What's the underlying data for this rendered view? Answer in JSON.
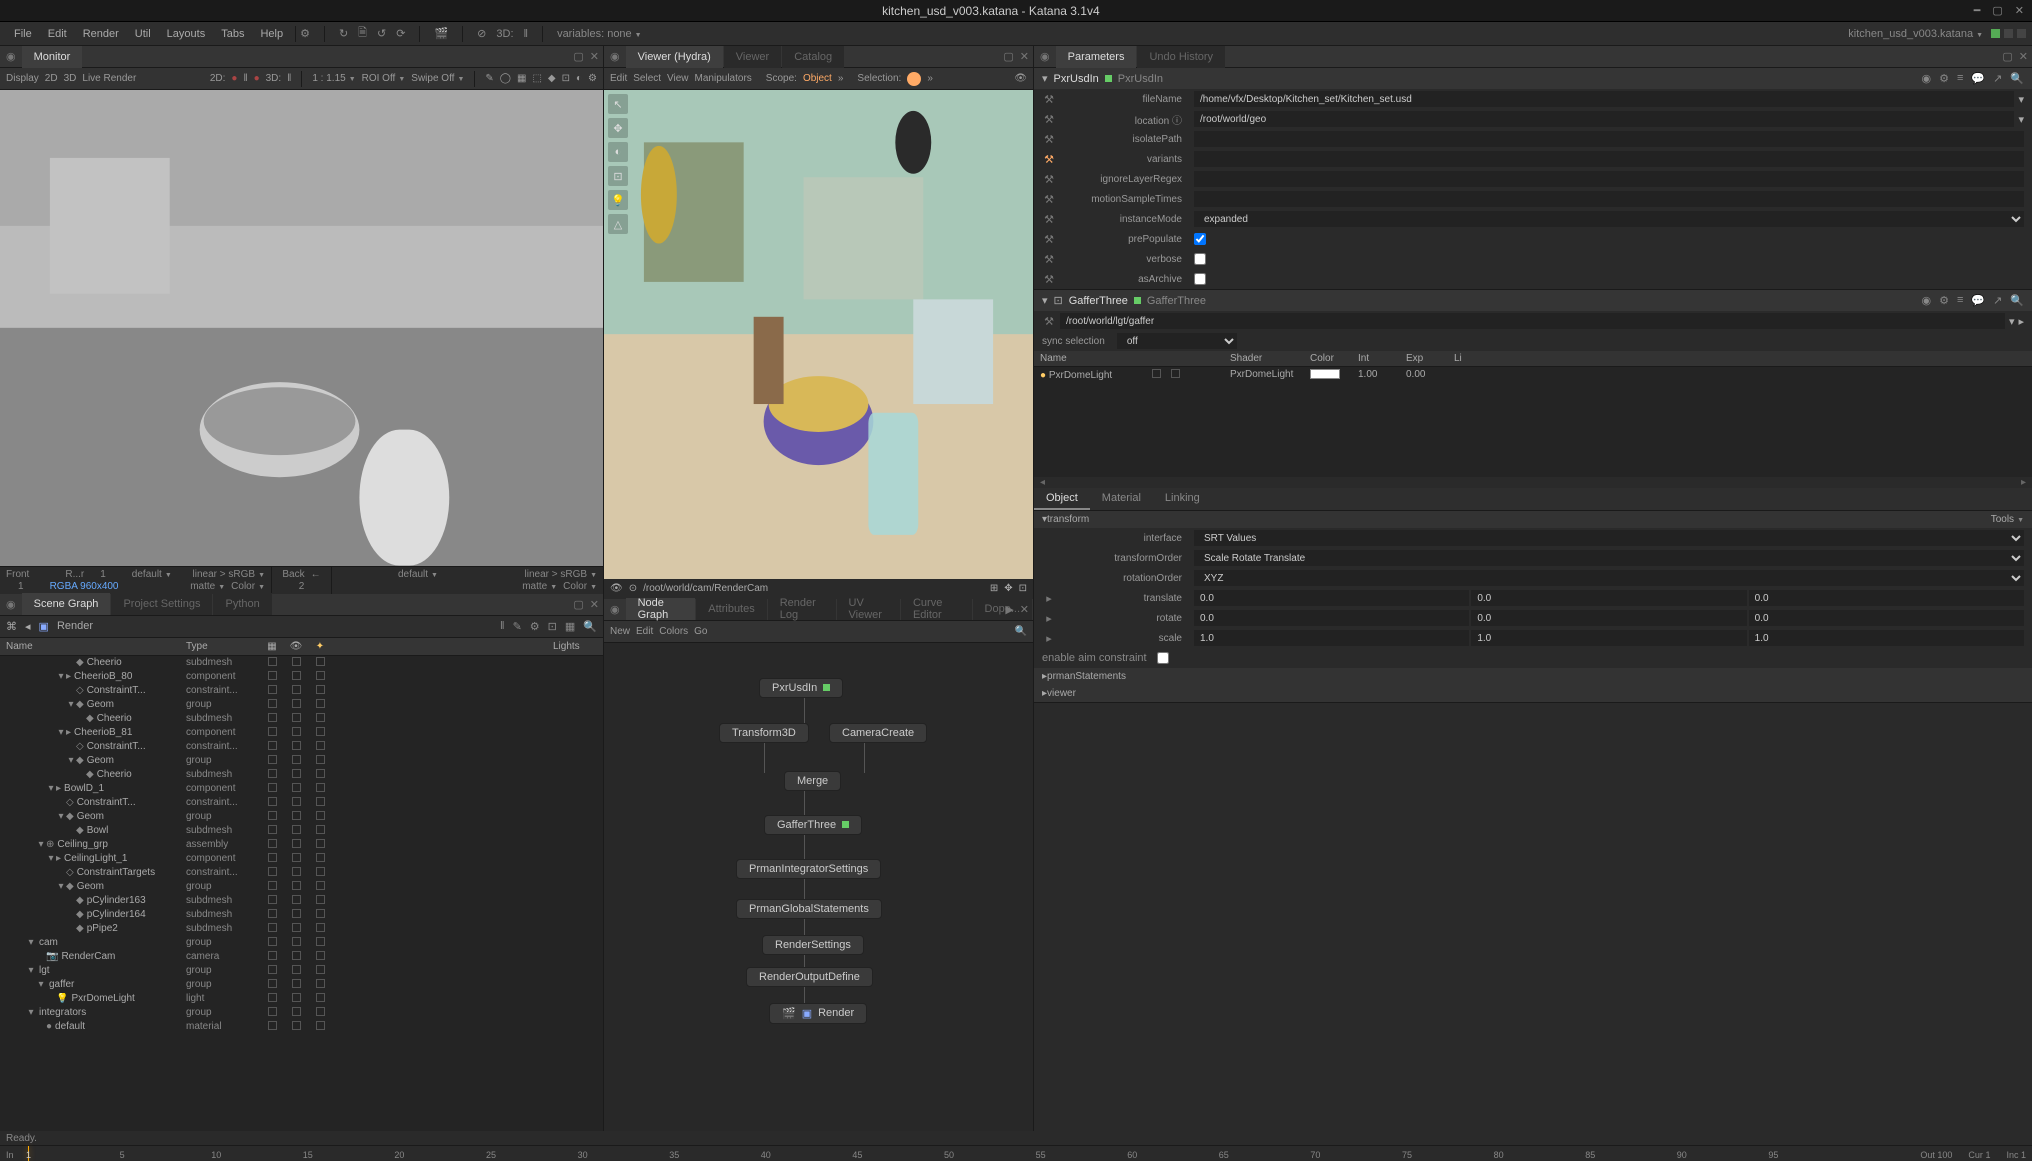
{
  "window": {
    "title": "kitchen_usd_v003.katana - Katana 3.1v4"
  },
  "menubar": {
    "items": [
      "File",
      "Edit",
      "Render",
      "Util",
      "Layouts",
      "Tabs",
      "Help"
    ],
    "variables_label": "variables: none",
    "mode_3d": "3D:",
    "filename_right": "kitchen_usd_v003.katana"
  },
  "monitor": {
    "tab": "Monitor",
    "toolbar": {
      "display": "Display",
      "d2": "2D",
      "d3": "3D",
      "live": "Live Render",
      "d2_label": "2D:",
      "d3_label": "3D:",
      "ratio": "1 : 1.15",
      "roi": "ROI Off",
      "swipe": "Swipe Off"
    },
    "channelA": {
      "front": "Front",
      "default": "default",
      "color": "linear > sRGB",
      "matte": "matte",
      "color2": "Color",
      "rgba": "RGBA 960x400",
      "rr": "R...r",
      "frame": "1",
      "back": "Back",
      "val2": "2"
    },
    "channelB": {
      "default": "default",
      "color": "linear > sRGB",
      "matte": "matte",
      "color2": "Color"
    }
  },
  "scenegraph": {
    "tabs": [
      "Scene Graph",
      "Project Settings",
      "Python"
    ],
    "breadcrumb_icon": "▣",
    "breadcrumb": "Render",
    "headers": {
      "name": "Name",
      "type": "Type",
      "lights": "Lights"
    },
    "rows": [
      {
        "indent": 6,
        "name": "Cheerio",
        "type": "subdmesh",
        "icon": "◆"
      },
      {
        "indent": 5,
        "name": "CheerioB_80",
        "type": "component",
        "icon": "▸",
        "exp": "▾"
      },
      {
        "indent": 6,
        "name": "ConstraintT...",
        "type": "constraint...",
        "icon": "◇"
      },
      {
        "indent": 6,
        "name": "Geom",
        "type": "group",
        "icon": "◆",
        "exp": "▾"
      },
      {
        "indent": 7,
        "name": "Cheerio",
        "type": "subdmesh",
        "icon": "◆"
      },
      {
        "indent": 5,
        "name": "CheerioB_81",
        "type": "component",
        "icon": "▸",
        "exp": "▾"
      },
      {
        "indent": 6,
        "name": "ConstraintT...",
        "type": "constraint...",
        "icon": "◇"
      },
      {
        "indent": 6,
        "name": "Geom",
        "type": "group",
        "icon": "◆",
        "exp": "▾"
      },
      {
        "indent": 7,
        "name": "Cheerio",
        "type": "subdmesh",
        "icon": "◆"
      },
      {
        "indent": 4,
        "name": "BowlD_1",
        "type": "component",
        "icon": "▸",
        "exp": "▾"
      },
      {
        "indent": 5,
        "name": "ConstraintT...",
        "type": "constraint...",
        "icon": "◇"
      },
      {
        "indent": 5,
        "name": "Geom",
        "type": "group",
        "icon": "◆",
        "exp": "▾"
      },
      {
        "indent": 6,
        "name": "Bowl",
        "type": "subdmesh",
        "icon": "◆"
      },
      {
        "indent": 3,
        "name": "Ceiling_grp",
        "type": "assembly",
        "icon": "⊕",
        "exp": "▾"
      },
      {
        "indent": 4,
        "name": "CeilingLight_1",
        "type": "component",
        "icon": "▸",
        "exp": "▾"
      },
      {
        "indent": 5,
        "name": "ConstraintTargets",
        "type": "constraint...",
        "icon": "◇"
      },
      {
        "indent": 5,
        "name": "Geom",
        "type": "group",
        "icon": "◆",
        "exp": "▾"
      },
      {
        "indent": 6,
        "name": "pCylinder163",
        "type": "subdmesh",
        "icon": "◆"
      },
      {
        "indent": 6,
        "name": "pCylinder164",
        "type": "subdmesh",
        "icon": "◆"
      },
      {
        "indent": 6,
        "name": "pPipe2",
        "type": "subdmesh",
        "icon": "◆"
      },
      {
        "indent": 2,
        "name": "cam",
        "type": "group",
        "icon": "",
        "exp": "▾"
      },
      {
        "indent": 3,
        "name": "RenderCam",
        "type": "camera",
        "icon": "📷"
      },
      {
        "indent": 2,
        "name": "lgt",
        "type": "group",
        "icon": "",
        "exp": "▾"
      },
      {
        "indent": 3,
        "name": "gaffer",
        "type": "group",
        "icon": "",
        "exp": "▾"
      },
      {
        "indent": 4,
        "name": "PxrDomeLight",
        "type": "light",
        "icon": "💡"
      },
      {
        "indent": 2,
        "name": "integrators",
        "type": "group",
        "icon": "",
        "exp": "▾"
      },
      {
        "indent": 3,
        "name": "default",
        "type": "material",
        "icon": "●"
      }
    ]
  },
  "hydra": {
    "tabs": [
      "Viewer (Hydra)",
      "Viewer",
      "Catalog"
    ],
    "menubar": [
      "Edit",
      "Select",
      "View",
      "Manipulators"
    ],
    "scope": "Scope:",
    "scope_val": "Object",
    "selection": "Selection:",
    "camera": "/root/world/cam/RenderCam"
  },
  "nodegraph": {
    "tabs": [
      "Node Graph",
      "Attributes",
      "Render Log",
      "UV Viewer",
      "Curve Editor",
      "Dope..."
    ],
    "menubar": [
      "New",
      "Edit",
      "Colors",
      "Go"
    ],
    "nodes": {
      "n1": "PxrUsdIn",
      "n2": "Transform3D",
      "n3": "CameraCreate",
      "n4": "Merge",
      "n5": "GafferThree",
      "n6": "PrmanIntegratorSettings",
      "n7": "PrmanGlobalStatements",
      "n8": "RenderSettings",
      "n9": "RenderOutputDefine",
      "n10": "Render"
    }
  },
  "parameters": {
    "tabs": [
      "Parameters",
      "Undo History"
    ],
    "pxrusdIn": {
      "title": "PxrUsdIn",
      "title2": "PxrUsdIn",
      "fileName": "fileName",
      "fileName_val": "/home/vfx/Desktop/Kitchen_set/Kitchen_set.usd",
      "location": "location",
      "location_val": "/root/world/geo",
      "isolatePath": "isolatePath",
      "variants": "variants",
      "ignoreLayerRegex": "ignoreLayerRegex",
      "motionSampleTimes": "motionSampleTimes",
      "instanceMode": "instanceMode",
      "instanceMode_val": "expanded",
      "prePopulate": "prePopulate",
      "verbose": "verbose",
      "asArchive": "asArchive"
    },
    "gaffer": {
      "title": "GafferThree",
      "title2": "GafferThree",
      "path": "/root/world/lgt/gaffer",
      "sync": "sync selection",
      "sync_val": "off",
      "cols": {
        "name": "Name",
        "shader": "Shader",
        "color": "Color",
        "int": "Int",
        "exp": "Exp",
        "li": "Li"
      },
      "light": {
        "name": "PxrDomeLight",
        "shader": "PxrDomeLight",
        "int": "1.00",
        "exp": "0.00"
      },
      "tabs": [
        "Object",
        "Material",
        "Linking"
      ],
      "transform_hdr": "transform",
      "tools": "Tools",
      "interface": "interface",
      "interface_val": "SRT Values",
      "transformOrder": "transformOrder",
      "transformOrder_val": "Scale Rotate Translate",
      "rotationOrder": "rotationOrder",
      "rotationOrder_val": "XYZ",
      "translate": "translate",
      "rotate": "rotate",
      "scale": "scale",
      "zero": "0.0",
      "one": "1.0",
      "enable_aim": "enable aim constraint",
      "prmanStatements": "prmanStatements",
      "viewer": "viewer"
    }
  },
  "status": {
    "ready": "Ready."
  },
  "timeline": {
    "in": "In",
    "one": "1",
    "ticks": [
      5,
      10,
      15,
      20,
      25,
      30,
      35,
      40,
      45,
      50,
      55,
      60,
      65,
      70,
      75,
      80,
      85,
      90,
      95
    ],
    "out": "Out",
    "out_v": "100",
    "cur": "Cur",
    "cur_v": "1",
    "inc": "Inc",
    "inc_v": "1"
  }
}
